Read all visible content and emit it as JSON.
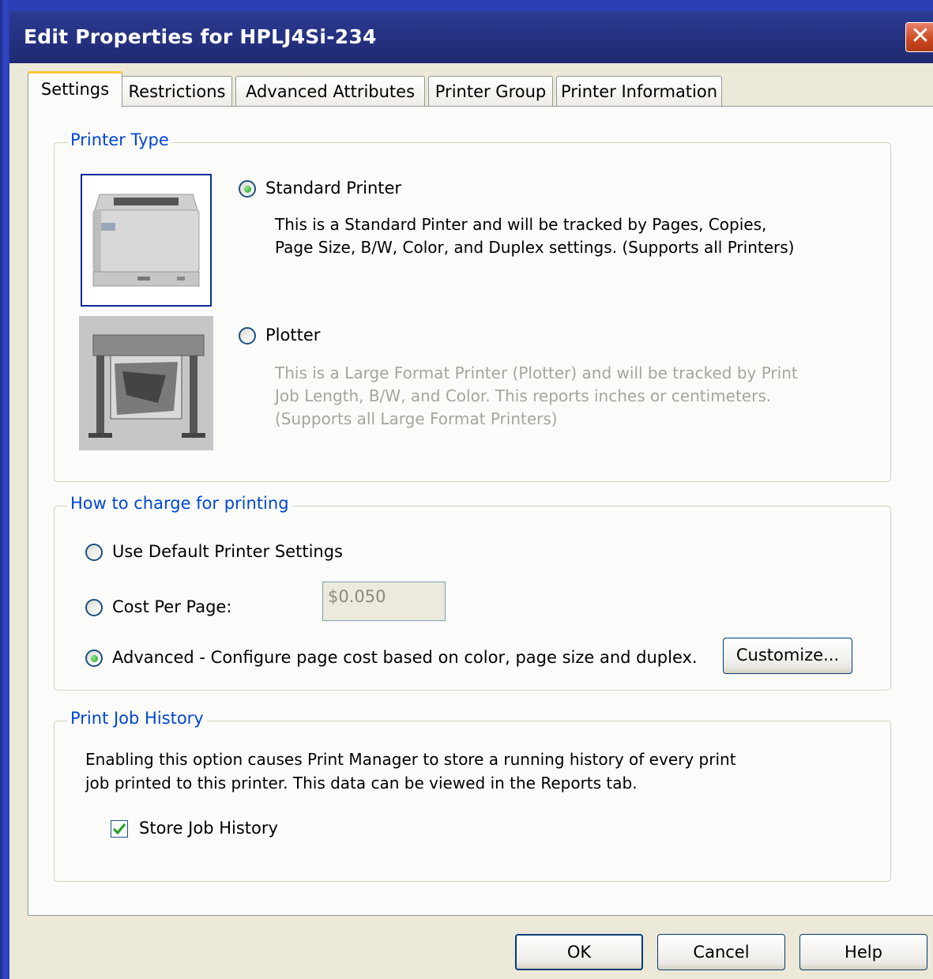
{
  "window": {
    "title": "Edit Properties for HPLJ4Si-234",
    "close_glyph": "✕"
  },
  "tabs": [
    {
      "label": "Settings",
      "active": true
    },
    {
      "label": "Restrictions",
      "active": false
    },
    {
      "label": "Advanced Attributes",
      "active": false
    },
    {
      "label": "Printer Group",
      "active": false
    },
    {
      "label": "Printer Information",
      "active": false
    }
  ],
  "printer_type": {
    "legend": "Printer Type",
    "standard": {
      "label": "Standard Printer",
      "checked": true,
      "desc_line1": "This is a Standard Pinter and will be tracked by Pages, Copies,",
      "desc_line2": "Page Size, B/W, Color, and Duplex settings. (Supports all Printers)"
    },
    "plotter": {
      "label": "Plotter",
      "checked": false,
      "desc_line1": "This is a Large Format Printer (Plotter) and will be tracked by Print",
      "desc_line2": "Job Length, B/W, and Color. This reports inches or centimeters.",
      "desc_line3": "(Supports all Large Format Printers)"
    }
  },
  "charging": {
    "legend": "How to charge for printing",
    "default_label": "Use Default Printer Settings",
    "cost_per_page_label": "Cost Per Page:",
    "cost_per_page_value": "$0.050",
    "advanced_label": "Advanced - Configure page cost based on color, page size and duplex.",
    "selected": "advanced",
    "customize_button": "Customize..."
  },
  "history": {
    "legend": "Print Job History",
    "desc_line1": "Enabling this option causes Print Manager to store a running history of every print",
    "desc_line2": "job printed to this printer.  This data can be viewed in the Reports tab.",
    "checkbox_label": "Store Job History",
    "checked": true
  },
  "footer": {
    "ok": "OK",
    "cancel": "Cancel",
    "help": "Help"
  },
  "colors": {
    "title_bar": "#24307e",
    "group_label": "#0046d5",
    "tab_highlight": "#ffc73c",
    "close_button": "#c9471e"
  },
  "icons": {
    "close": "close-icon",
    "standard_printer": "laser-printer-image",
    "plotter": "plotter-image",
    "checkbox": "checkmark-icon"
  }
}
